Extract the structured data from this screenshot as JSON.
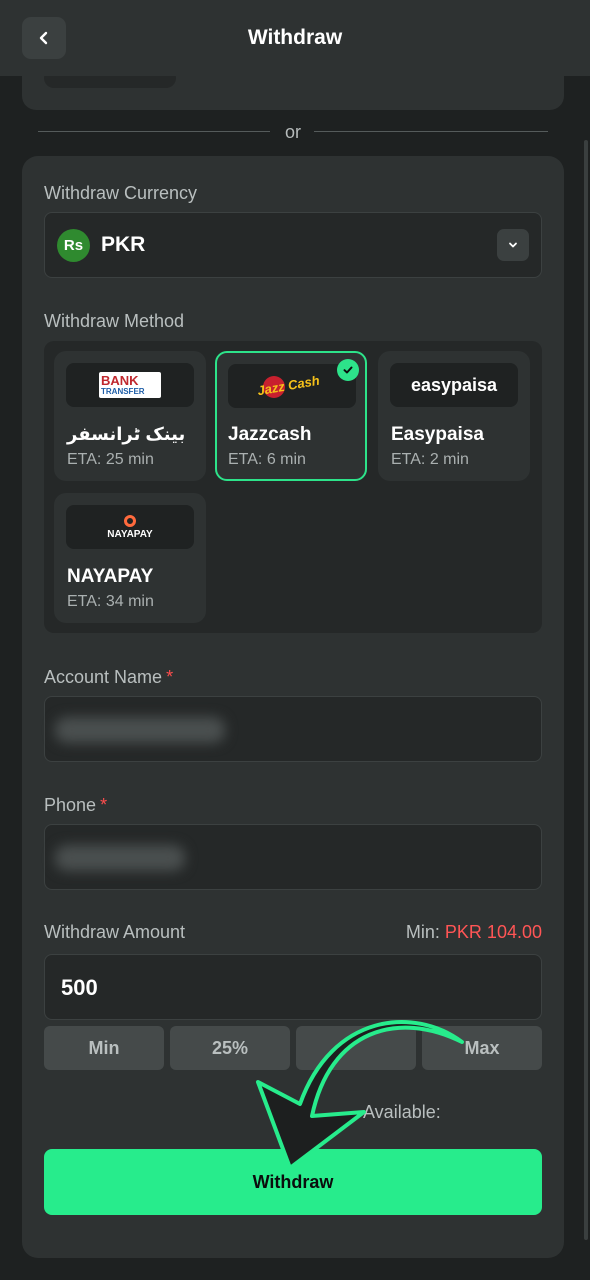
{
  "header": {
    "title": "Withdraw"
  },
  "separator": {
    "text": "or"
  },
  "form": {
    "currency_label": "Withdraw Currency",
    "currency_badge": "Rs",
    "currency_value": "PKR",
    "method_label": "Withdraw Method",
    "methods": [
      {
        "name": "بینک ٹرانسفر",
        "eta": "ETA: 25 min",
        "logo_top": "BANK",
        "logo_bottom": "TRANSFER",
        "selected": false
      },
      {
        "name": "Jazzcash",
        "eta": "ETA: 6 min",
        "logo": "Jazz Cash",
        "selected": true
      },
      {
        "name": "Easypaisa",
        "eta": "ETA: 2 min",
        "logo": "easypaisa",
        "selected": false
      },
      {
        "name": "NAYAPAY",
        "eta": "ETA: 34 min",
        "logo": "NAYAPAY",
        "selected": false
      }
    ],
    "account_name_label": "Account Name",
    "phone_label": "Phone",
    "required_mark": "*",
    "amount_label": "Withdraw Amount",
    "min_prefix": "Min:",
    "min_value": "PKR 104.00",
    "amount_value": "500",
    "quick_buttons": [
      "Min",
      "25%",
      "",
      "Max"
    ],
    "available_label": "Available:",
    "submit_label": "Withdraw"
  },
  "colors": {
    "accent": "#27ec8c",
    "required": "#ff4d4d",
    "card": "#2e3232",
    "background": "#1e2121"
  }
}
